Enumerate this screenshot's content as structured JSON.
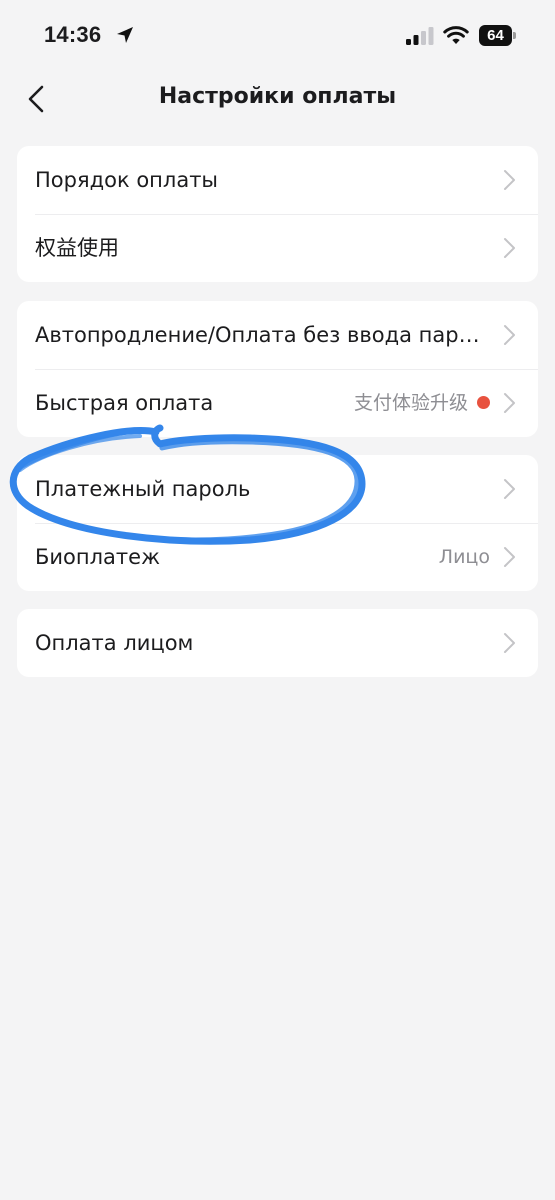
{
  "status_bar": {
    "time": "14:36",
    "battery": "64",
    "icons": [
      "location-arrow-icon",
      "cellular-signal-icon",
      "wifi-icon",
      "battery-icon"
    ]
  },
  "nav": {
    "title": "Настройки оплаты",
    "back_icon": "chevron-left-icon"
  },
  "groups": [
    {
      "rows": [
        {
          "label": "Порядок оплаты",
          "value": ""
        },
        {
          "label": "权益使用",
          "value": ""
        }
      ]
    },
    {
      "rows": [
        {
          "label": "Автопродление/Оплата без ввода пароля",
          "value": ""
        },
        {
          "label": "Быстрая оплата",
          "value": "支付体验升级",
          "badge": "red-dot"
        }
      ]
    },
    {
      "rows": [
        {
          "label": "Платежный пароль",
          "value": ""
        },
        {
          "label": "Биоплатеж",
          "value": "Лицо"
        }
      ]
    },
    {
      "rows": [
        {
          "label": "Оплата лицом",
          "value": ""
        }
      ]
    }
  ],
  "colors": {
    "background": "#f4f4f5",
    "card": "#ffffff",
    "text": "#1c1c1e",
    "secondary_text": "#8e8e93",
    "badge_red": "#e8523f",
    "annotation_blue": "#1f7ae8"
  }
}
